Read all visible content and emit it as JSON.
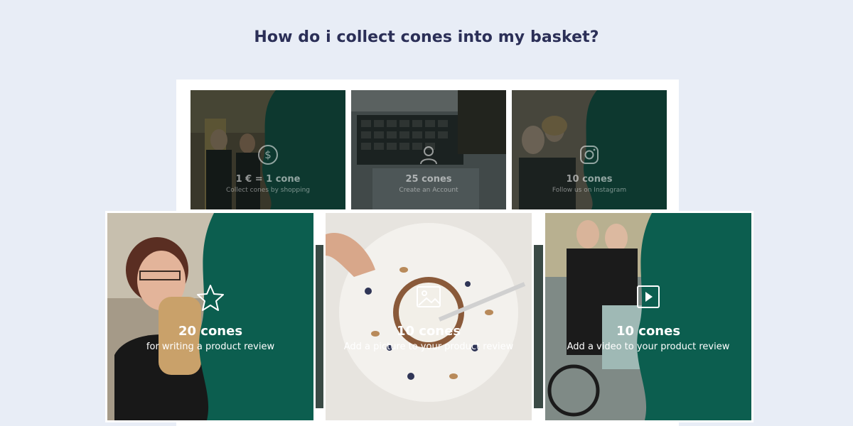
{
  "page": {
    "title": "How do i collect cones into my basket?"
  },
  "colors": {
    "accent": "#0c5e4f",
    "title": "#2b2f57",
    "background": "#e8edf6"
  },
  "back_cards": [
    {
      "icon": "dollar-coin-icon",
      "heading": "1 € = 1 cone",
      "subtitle": "Collect cones by shopping"
    },
    {
      "icon": "user-icon",
      "heading": "25 cones",
      "subtitle": "Create an Account"
    },
    {
      "icon": "instagram-icon",
      "heading": "10 cones",
      "subtitle": "Follow us on Instagram"
    }
  ],
  "front_cards": [
    {
      "icon": "star-icon",
      "heading": "20 cones",
      "subtitle": "for writing a product review"
    },
    {
      "icon": "image-icon",
      "heading": "10 cones",
      "subtitle": "Add a picture to your product review"
    },
    {
      "icon": "video-play-icon",
      "heading": "10 cones",
      "subtitle": "Add a video to your product review"
    }
  ]
}
